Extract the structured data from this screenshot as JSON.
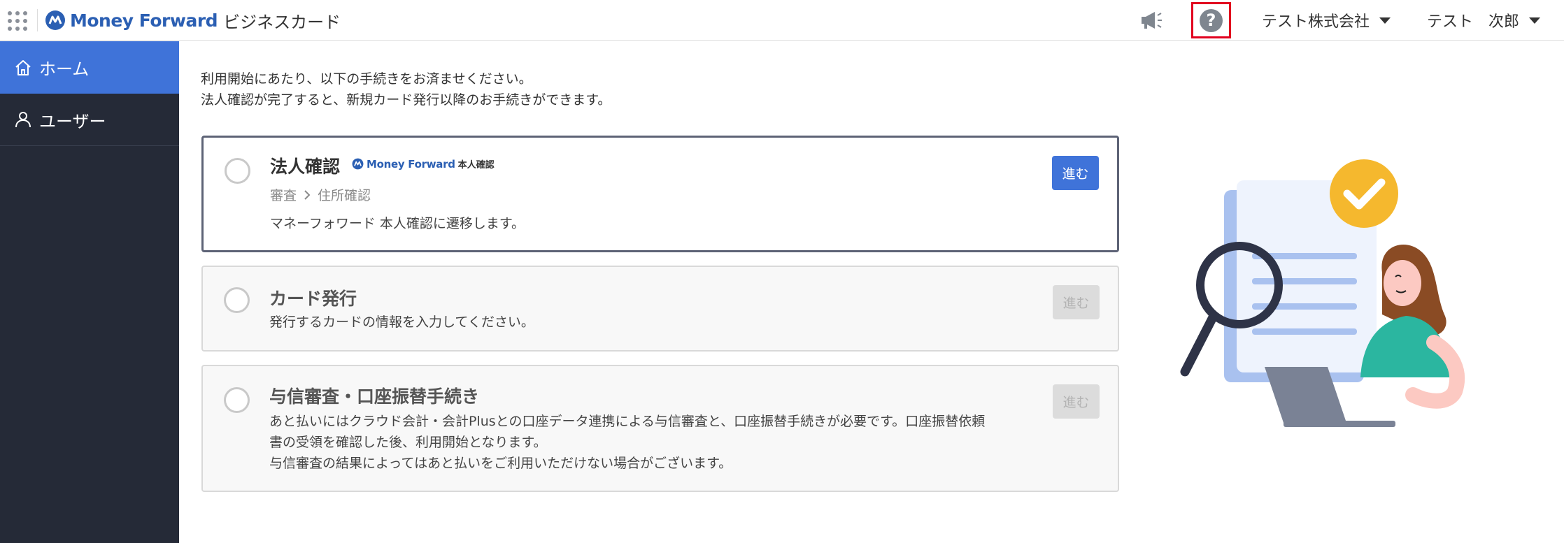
{
  "header": {
    "brand_name": "Money Forward",
    "product_name": "ビジネスカード",
    "company_name": "テスト株式会社",
    "user_name": "テスト　次郎",
    "help_icon": "?",
    "icons": [
      "apps-grid-icon",
      "megaphone-icon",
      "help-icon",
      "caret-down-icon"
    ]
  },
  "sidebar": {
    "items": [
      {
        "label": "ホーム",
        "icon": "home-icon",
        "active": true
      },
      {
        "label": "ユーザー",
        "icon": "user-icon",
        "active": false
      }
    ]
  },
  "main": {
    "intro_line1": "利用開始にあたり、以下の手続きをお済ませください。",
    "intro_line2": "法人確認が完了すると、新規カード発行以降のお手続きができます。",
    "steps": [
      {
        "title": "法人確認",
        "badge_brand": "Money Forward",
        "badge_sub": "本人確認",
        "crumb_1": "審査",
        "crumb_2": "住所確認",
        "description": "マネーフォワード 本人確認に遷移します。",
        "button": "進む",
        "enabled": true
      },
      {
        "title": "カード発行",
        "description": "発行するカードの情報を入力してください。",
        "button": "進む",
        "enabled": false
      },
      {
        "title": "与信審査・口座振替手続き",
        "description_line1": "あと払いにはクラウド会計・会計Plusとの口座データ連携による与信審査と、口座振替手続きが必要です。口座振替依頼",
        "description_line2": "書の受領を確認した後、利用開始となります。",
        "description_line3": "与信審査の結果によってはあと払いをご利用いただけない場合がございます。",
        "button": "進む",
        "enabled": false
      }
    ]
  },
  "colors": {
    "primary": "#3f73d9",
    "sidebar_bg": "#252a37",
    "brand_blue": "#2b5fb3",
    "highlight_red": "#e1001e",
    "check_yellow": "#f5b82e"
  }
}
